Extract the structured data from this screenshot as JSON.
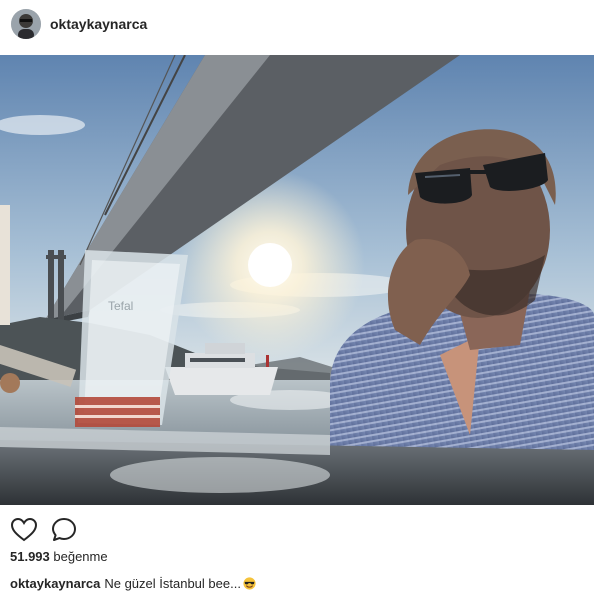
{
  "post": {
    "username": "oktaykaynarca",
    "photo_label": "Tefal"
  },
  "actions": {
    "like_icon": "heart-icon",
    "comment_icon": "comment-icon"
  },
  "likes": {
    "count": "51.993",
    "label": "beğenme"
  },
  "caption": {
    "username": "oktaykaynarca",
    "text": "Ne güzel İstanbul bee...",
    "emoji": "smiling-face-with-sunglasses-emoji"
  },
  "colors": {
    "text": "#262626",
    "sky_top": "#5f84b0",
    "sun": "#fff8e6"
  }
}
